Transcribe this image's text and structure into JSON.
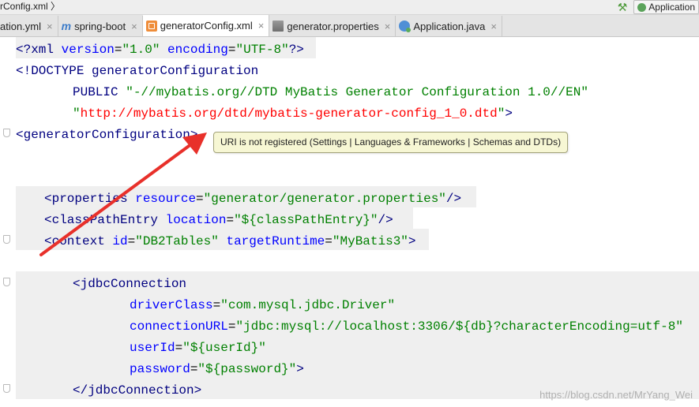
{
  "breadcrumb": "rConfig.xml",
  "run_config": "Application",
  "tabs": [
    {
      "label": "ation.yml",
      "icon": "yaml-file-icon"
    },
    {
      "label": "spring-boot",
      "icon": "mybatis-icon"
    },
    {
      "label": "generatorConfig.xml",
      "icon": "xml-file-icon",
      "active": true
    },
    {
      "label": "generator.properties",
      "icon": "properties-file-icon"
    },
    {
      "label": "Application.java",
      "icon": "java-class-icon"
    }
  ],
  "close_glyph": "×",
  "code": {
    "l1": {
      "a": "<?",
      "b": "xml",
      "c": " version",
      "d": "=",
      "e": "\"1.0\"",
      "f": " encoding",
      "g": "=",
      "h": "\"UTF-8\"",
      "i": "?>"
    },
    "l2": {
      "a": "<!DOCTYPE ",
      "b": "generatorConfiguration"
    },
    "l3": {
      "a": "PUBLIC ",
      "b": "\"-//mybatis.org//DTD MyBatis Generator Configuration 1.0//EN\""
    },
    "l4": {
      "a": "\"",
      "b": "http://mybatis.org/dtd/mybatis-generator-config_1_0.dtd",
      "c": "\"",
      "d": ">"
    },
    "l5": {
      "a": "<generatorConfiguration",
      "b": ">"
    },
    "l6": {
      "a": "<properties",
      "b": " resource",
      "c": "=",
      "d": "\"generator/generator.properties\"",
      "e": "/>"
    },
    "l7": {
      "a": "<classPathEntry",
      "b": " location",
      "c": "=",
      "d": "\"${classPathEntry}\"",
      "e": "/>"
    },
    "l8": {
      "a": "<context",
      "b": " id",
      "c": "=",
      "d": "\"DB2Tables\"",
      "e": " targetRuntime",
      "f": "=",
      "g": "\"MyBatis3\"",
      "h": ">"
    },
    "l9": {
      "a": "<jdbcConnection"
    },
    "l10": {
      "a": "driverClass",
      "b": "=",
      "c": "\"com.mysql.jdbc.Driver\""
    },
    "l11": {
      "a": "connectionURL",
      "b": "=",
      "c": "\"jdbc:mysql://localhost:3306/${db}?characterEncoding=utf-8\""
    },
    "l12": {
      "a": "userId",
      "b": "=",
      "c": "\"${userId}\""
    },
    "l13": {
      "a": "password",
      "b": "=",
      "c": "\"${password}\"",
      "d": ">"
    },
    "l14": {
      "a": "</jdbcConnection>"
    }
  },
  "tooltip": "URI is not registered (Settings | Languages & Frameworks | Schemas and DTDs)",
  "watermark": "https://blog.csdn.net/MrYang_Wei",
  "colors": {
    "tag": "#000080",
    "attribute": "#0000ff",
    "value": "#008000",
    "unregistered_uri": "#ff0000",
    "annotation_arrow": "#e8302a"
  }
}
